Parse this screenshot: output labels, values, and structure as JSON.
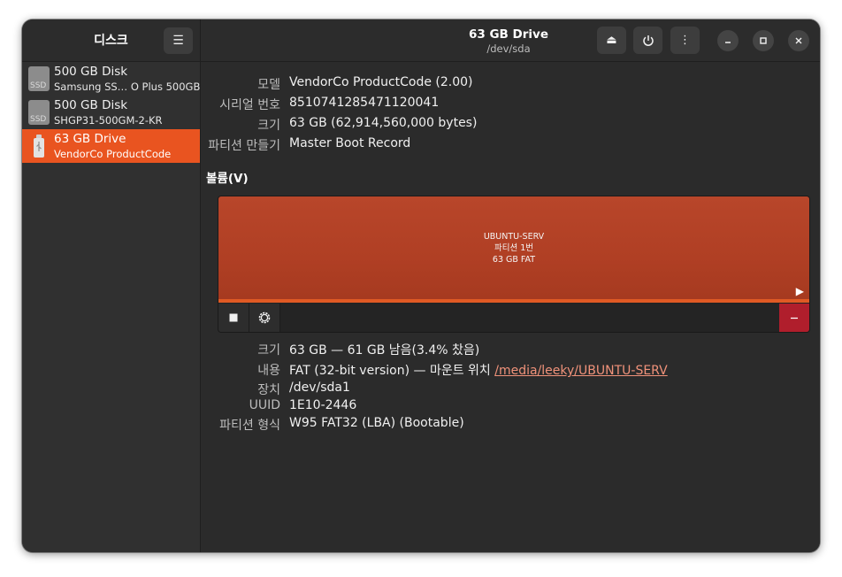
{
  "app": {
    "title": "디스크",
    "menu_icon": "hamburger-icon"
  },
  "drives": [
    {
      "name": "500 GB Disk",
      "subtitle": "Samsung SS…  O Plus 500GB",
      "icon": "ssd-icon",
      "icon_text": "SSD",
      "selected": false
    },
    {
      "name": "500 GB Disk",
      "subtitle": "SHGP31-500GM-2-KR",
      "icon": "ssd-icon",
      "icon_text": "SSD",
      "selected": false
    },
    {
      "name": "63 GB Drive",
      "subtitle": "VendorCo ProductCode",
      "icon": "usb-drive-icon",
      "selected": true
    }
  ],
  "header": {
    "title": "63 GB Drive",
    "subtitle": "/dev/sda",
    "buttons": [
      "eject-icon",
      "power-icon",
      "more-icon"
    ],
    "window_controls": [
      "minimize-icon",
      "maximize-icon",
      "close-icon"
    ]
  },
  "drive_info": {
    "model_label": "모델",
    "model_value": "VendorCo ProductCode (2.00)",
    "serial_label": "시리얼 번호",
    "serial_value": "8510741285471120041",
    "size_label": "크기",
    "size_value": "63 GB (62,914,560,000 bytes)",
    "partitioning_label": "파티션 만들기",
    "partitioning_value": "Master Boot Record"
  },
  "volumes": {
    "section_title": "볼륨(V)",
    "partition": {
      "label": "UBUNTU-SERV",
      "number": "파티션 1번",
      "size_fs": "63 GB FAT"
    },
    "toolbar": [
      "stop-icon",
      "gear-icon",
      "minus-icon"
    ]
  },
  "volume_info": {
    "size_label": "크기",
    "size_value": "63 GB — 61 GB 남음(3.4% 찼음)",
    "contents_label": "내용",
    "contents_value": "FAT (32-bit version) — 마운트 위치 ",
    "mount_link": "/media/leeky/UBUNTU-SERV",
    "device_label": "장치",
    "device_value": "/dev/sda1",
    "uuid_label": "UUID",
    "uuid_value": "1E10-2446",
    "type_label": "파티션 형식",
    "type_value": "W95 FAT32 (LBA) (Bootable)"
  },
  "colors": {
    "accent": "#e95420",
    "partition": "#b03f24",
    "delete": "#b01e2c",
    "link": "#f0927a"
  }
}
